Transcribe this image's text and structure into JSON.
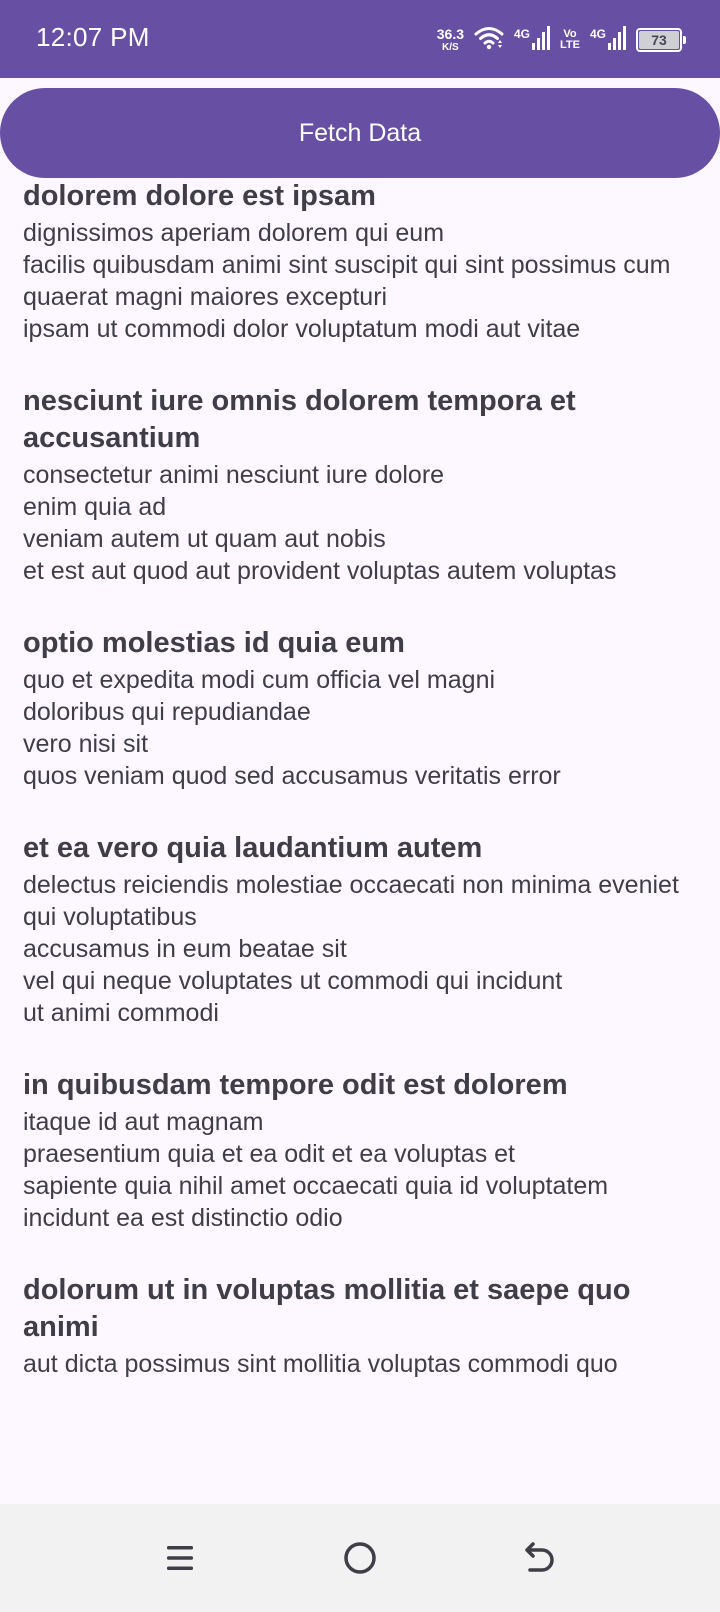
{
  "status_bar": {
    "time": "12:07 PM",
    "speed_value": "36.3",
    "speed_unit": "K/S",
    "network1": "4G",
    "volte_top": "Vo",
    "volte_bottom": "LTE",
    "network2": "4G",
    "battery": "73",
    "icons": [
      "wifi-icon",
      "signal-icon",
      "signal-icon",
      "battery-icon"
    ]
  },
  "fetch_button": {
    "label": "Fetch Data"
  },
  "posts": [
    {
      "title": "dolorem dolore est ipsam",
      "body": "dignissimos aperiam dolorem qui eum\nfacilis quibusdam animi sint suscipit qui sint possimus cum\nquaerat magni maiores excepturi\nipsam ut commodi dolor voluptatum modi aut vitae"
    },
    {
      "title": "nesciunt iure omnis dolorem tempora et accusantium",
      "body": "consectetur animi nesciunt iure dolore\nenim quia ad\nveniam autem ut quam aut nobis\net est aut quod aut provident voluptas autem voluptas"
    },
    {
      "title": "optio molestias id quia eum",
      "body": "quo et expedita modi cum officia vel magni\ndoloribus qui repudiandae\nvero nisi sit\nquos veniam quod sed accusamus veritatis error"
    },
    {
      "title": "et ea vero quia laudantium autem",
      "body": "delectus reiciendis molestiae occaecati non minima eveniet qui voluptatibus\naccusamus in eum beatae sit\nvel qui neque voluptates ut commodi qui incidunt\nut animi commodi"
    },
    {
      "title": "in quibusdam tempore odit est dolorem",
      "body": "itaque id aut magnam\npraesentium quia et ea odit et ea voluptas et\nsapiente quia nihil amet occaecati quia id voluptatem\nincidunt ea est distinctio odio"
    },
    {
      "title": "dolorum ut in voluptas mollitia et saepe quo animi",
      "body": "aut dicta possimus sint mollitia voluptas commodi quo"
    }
  ],
  "nav_bar": {
    "icons": [
      "menu-icon",
      "home-icon",
      "back-icon"
    ]
  },
  "colors": {
    "primary": "#6750a4",
    "background": "#fdf8ff",
    "text": "#3f3d45",
    "nav_background": "#f2f2f2"
  }
}
